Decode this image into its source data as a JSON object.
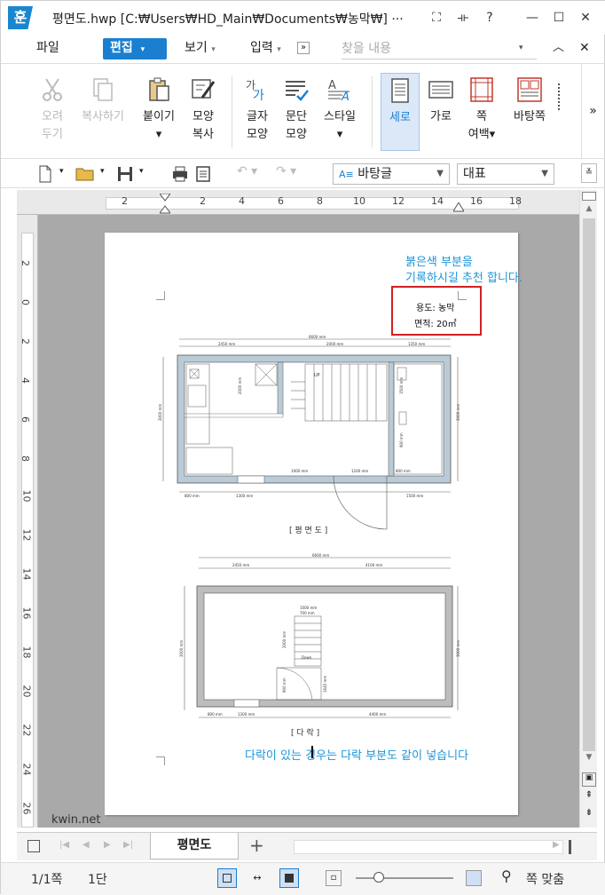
{
  "app": {
    "logo": "훈",
    "title": "평면도.hwp [C:₩Users₩HD_Main₩Documents₩농막₩] ···",
    "title_buttons": [
      "⛶",
      "⟛",
      "?",
      "—",
      "☐",
      "✕"
    ]
  },
  "menu": {
    "items": [
      "파일",
      "편집",
      "보기",
      "입력"
    ],
    "active": "편집",
    "more": "»",
    "search_placeholder": "찾을 내용"
  },
  "ribbon": {
    "buttons": [
      {
        "label1": "오려",
        "label2": "두기",
        "icon": "scissors-icon",
        "disabled": true
      },
      {
        "label1": "복사하기",
        "label2": "",
        "icon": "copy-icon",
        "disabled": true
      },
      {
        "label1": "붙이기",
        "label2": "▾",
        "icon": "paste-icon",
        "disabled": false
      },
      {
        "label1": "모양",
        "label2": "복사",
        "icon": "format-painter-icon",
        "disabled": false
      },
      {
        "label1": "글자",
        "label2": "모양",
        "icon": "char-shape-icon",
        "disabled": false
      },
      {
        "label1": "문단",
        "label2": "모양",
        "icon": "paragraph-shape-icon",
        "disabled": false
      },
      {
        "label1": "스타일",
        "label2": "▾",
        "icon": "style-icon",
        "disabled": false
      },
      {
        "label1": "세로",
        "label2": "",
        "icon": "portrait-icon",
        "disabled": false,
        "selected": true
      },
      {
        "label1": "가로",
        "label2": "",
        "icon": "landscape-icon",
        "disabled": false
      },
      {
        "label1": "쪽",
        "label2": "여백▾",
        "icon": "margin-icon",
        "disabled": false
      },
      {
        "label1": "바탕쪽",
        "label2": "",
        "icon": "master-page-icon",
        "disabled": false
      }
    ],
    "expand": "»"
  },
  "toolbar2": {
    "style_value": "바탕글",
    "font_value": "대표"
  },
  "rulers": {
    "h_numbers": [
      "2",
      "2",
      "4",
      "6",
      "8",
      "10",
      "12",
      "14",
      "16",
      "18"
    ],
    "v_numbers": [
      "2",
      "0",
      "2",
      "4",
      "6",
      "8",
      "10",
      "12",
      "14",
      "16",
      "18",
      "20",
      "22",
      "24",
      "26"
    ]
  },
  "document": {
    "note_line1": "붉은색 부분을",
    "note_line2": "기록하시길 추천 합니다.",
    "usage_label": "용도: 농막",
    "area_label": "면적: 20㎡",
    "caption_floor": "[ 평 면 도 ]",
    "caption_attic": "[ 다 락 ]",
    "bottom_note": "다락이 있는 경우는 다락 부분도 같이 넣습니다",
    "plan_dims_top": [
      "6600 mm",
      "2450 mm",
      "2000 mm",
      "1350 mm"
    ],
    "plan_dims_bottom": [
      "800 mm",
      "1300 mm",
      "1500 mm"
    ],
    "plan_dims_inner": [
      "1000 mm",
      "1200 mm",
      "800 mm"
    ],
    "plan_dims_side": [
      "3000 mm",
      "3000 mm",
      "2000 mm",
      "1500 mm",
      "900 mm"
    ],
    "attic_dims_top": [
      "6600 mm",
      "2450 mm",
      "4100 mm"
    ],
    "attic_dims_bottom": [
      "800 mm",
      "1300 mm",
      "4400 mm"
    ],
    "attic_dims_inner": [
      "1000 mm",
      "700 mm",
      "2000 mm",
      "900 mm",
      "1645 mm"
    ],
    "attic_dims_side": [
      "3000 mm",
      "3000 mm"
    ],
    "stair_up": "UP",
    "stair_down": "Down"
  },
  "watermark": "kwin.net",
  "tabbar": {
    "tab": "평면도",
    "add": "+"
  },
  "status": {
    "page": "1/1쪽",
    "column": "1단",
    "zoom_label": "쪽 맞춤"
  }
}
